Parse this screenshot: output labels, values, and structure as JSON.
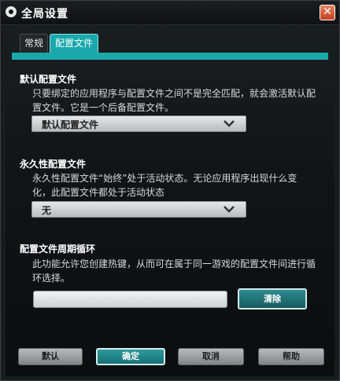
{
  "window": {
    "title": "全局设置",
    "close_symbol": "✕"
  },
  "tabs": [
    {
      "label": "常规",
      "active": false
    },
    {
      "label": "配置文件",
      "active": true
    }
  ],
  "default_profile": {
    "title": "默认配置文件",
    "description": "只要绑定的应用程序与配置文件之间不是完全匹配，就会激活默认配置文件。它是一个后备配置文件。",
    "selected": "默认配置文件"
  },
  "persistent_profile": {
    "title": "永久性配置文件",
    "description": "永久性配置文件“始终”处于活动状态。无论应用程序出现什么变化，此配置文件都处于活动状态",
    "selected": "无"
  },
  "profile_cycle": {
    "title": "配置文件周期循环",
    "description": "此功能允许您创建热键，从而可在属于同一游戏的配置文件间进行循环选择。",
    "field_value": "",
    "clear_label": "清除"
  },
  "footer": {
    "default_label": "默认",
    "ok_label": "确定",
    "cancel_label": "取消",
    "help_label": "帮助"
  },
  "colors": {
    "accent": "#19a9ad",
    "background": "#0d1012"
  },
  "icons": {
    "app": "logitech-g-icon",
    "close": "close-icon",
    "dropdown": "chevron-down-icon"
  }
}
